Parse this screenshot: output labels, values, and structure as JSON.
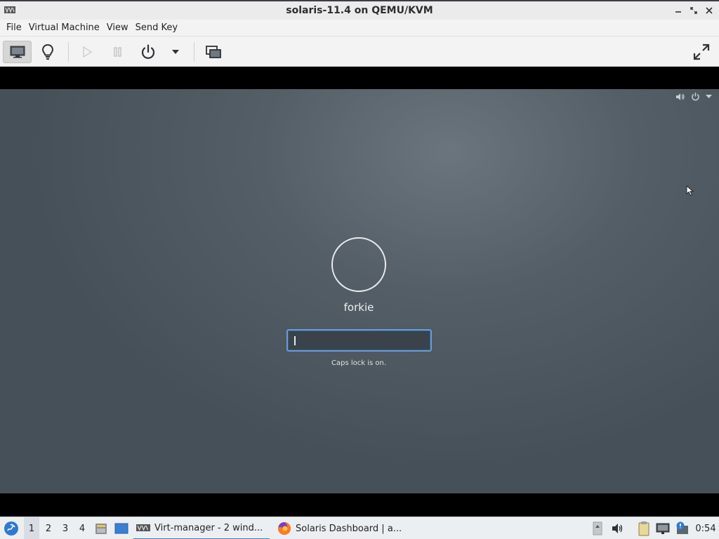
{
  "window": {
    "title": "solaris-11.4 on QEMU/KVM",
    "icon": "virt-manager-icon",
    "controls": [
      "minimize-icon",
      "maximize-icon",
      "close-icon"
    ]
  },
  "menubar": {
    "items": [
      "File",
      "Virtual Machine",
      "View",
      "Send Key"
    ]
  },
  "toolbar": {
    "buttons": [
      {
        "name": "console-button",
        "icon": "monitor-icon",
        "pressed": true
      },
      {
        "name": "details-button",
        "icon": "lightbulb-icon"
      },
      {
        "name": "run-button",
        "icon": "play-icon",
        "disabled": true
      },
      {
        "name": "pause-button",
        "icon": "pause-icon",
        "disabled": true
      },
      {
        "name": "shutdown-button",
        "icon": "power-icon"
      },
      {
        "name": "shutdown-menu-button",
        "icon": "chevron-down-icon"
      },
      {
        "name": "snapshots-button",
        "icon": "screens-icon"
      },
      {
        "name": "fullscreen-button",
        "icon": "fullscreen-icon"
      }
    ]
  },
  "vm": {
    "status_icons": [
      "volume-icon",
      "power-icon",
      "chevron-down-icon"
    ],
    "login": {
      "username": "forkie",
      "password_value": "",
      "caps_lock_message": "Caps lock is on."
    },
    "colors": {
      "background": "#56606a",
      "focus_ring": "#6a9bd3"
    }
  },
  "taskbar": {
    "start_icon": "start-menu-icon",
    "workspaces": [
      "1",
      "2",
      "3",
      "4"
    ],
    "active_workspace": "1",
    "launchers": [
      "file-manager-icon",
      "desktop-icon"
    ],
    "tasks": [
      {
        "label": "Virt-manager - 2 wind...",
        "icon": "virt-manager-icon",
        "active": true
      },
      {
        "label": "Solaris Dashboard | a...",
        "icon": "firefox-icon",
        "active": false
      }
    ],
    "tray_icons": [
      "tray-scroll-icon",
      "volume-icon",
      "clipboard-icon",
      "network-icon",
      "notification-icon"
    ],
    "clock": "0:54"
  }
}
